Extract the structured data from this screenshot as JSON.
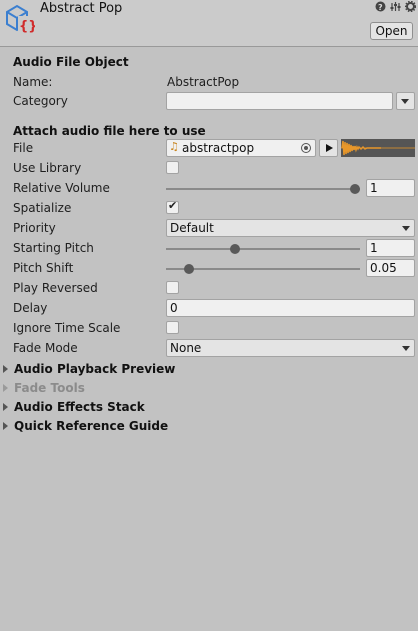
{
  "header": {
    "title": "Abstract Pop",
    "open_label": "Open",
    "icons": [
      "help-icon",
      "preset-icon",
      "gear-icon"
    ]
  },
  "audio_file_object": {
    "section_title": "Audio File Object",
    "name_label": "Name:",
    "name_value": "AbstractPop",
    "category_label": "Category",
    "category_value": ""
  },
  "attach": {
    "section_title": "Attach audio file here to use",
    "file_label": "File",
    "file_value": "abstractpop",
    "use_library_label": "Use Library",
    "use_library": false,
    "relative_volume_label": "Relative Volume",
    "relative_volume": "1",
    "relative_volume_level": 1.0,
    "spatialize_label": "Spatialize",
    "spatialize": true,
    "priority_label": "Priority",
    "priority_value": "Default",
    "starting_pitch_label": "Starting Pitch",
    "starting_pitch": "1",
    "starting_pitch_level": 0.35,
    "pitch_shift_label": "Pitch Shift",
    "pitch_shift": "0.05",
    "pitch_shift_level": 0.1,
    "play_reversed_label": "Play Reversed",
    "play_reversed": false,
    "delay_label": "Delay",
    "delay_value": "0",
    "ignore_time_scale_label": "Ignore Time Scale",
    "ignore_time_scale": false,
    "fade_mode_label": "Fade Mode",
    "fade_mode_value": "None"
  },
  "foldouts": {
    "audio_playback_preview": "Audio Playback Preview",
    "fade_tools": "Fade Tools",
    "audio_effects_stack": "Audio Effects Stack",
    "quick_reference_guide": "Quick Reference Guide"
  },
  "colors": {
    "background": "#c2c2c2",
    "waveform": "#e8972a",
    "waveform_bg": "#555555",
    "component_icon_blue": "#3b7fd0",
    "component_icon_red": "#d02b2b"
  }
}
